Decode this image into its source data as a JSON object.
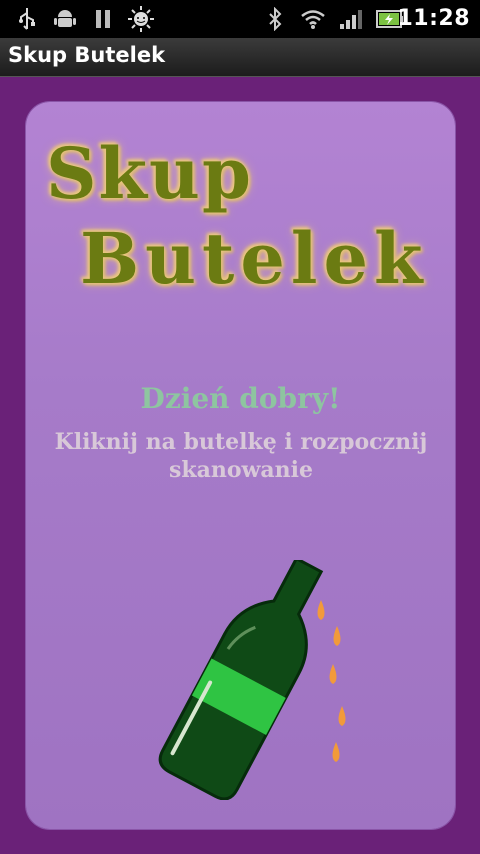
{
  "statusbar": {
    "time": "11:28",
    "icons": [
      "usb-icon",
      "android-debug-icon",
      "pause-icon",
      "sun-icon",
      "bluetooth-icon",
      "wifi-icon",
      "signal-icon",
      "battery-icon"
    ]
  },
  "titlebar": {
    "title": "Skup Butelek"
  },
  "logo": {
    "line1": "Skup",
    "line2": "Butelek"
  },
  "main": {
    "greeting": "Dzień dobry!",
    "instruction": "Kliknij na butelkę i rozpocznij skanowanie"
  },
  "colors": {
    "background": "#6a2178",
    "card": "#a67bc9",
    "logo_text": "#6b7b12",
    "greeting": "#8ec5a0",
    "bottle": "#0f4a16",
    "label": "#2fc443",
    "drops": "#f29a3a"
  }
}
